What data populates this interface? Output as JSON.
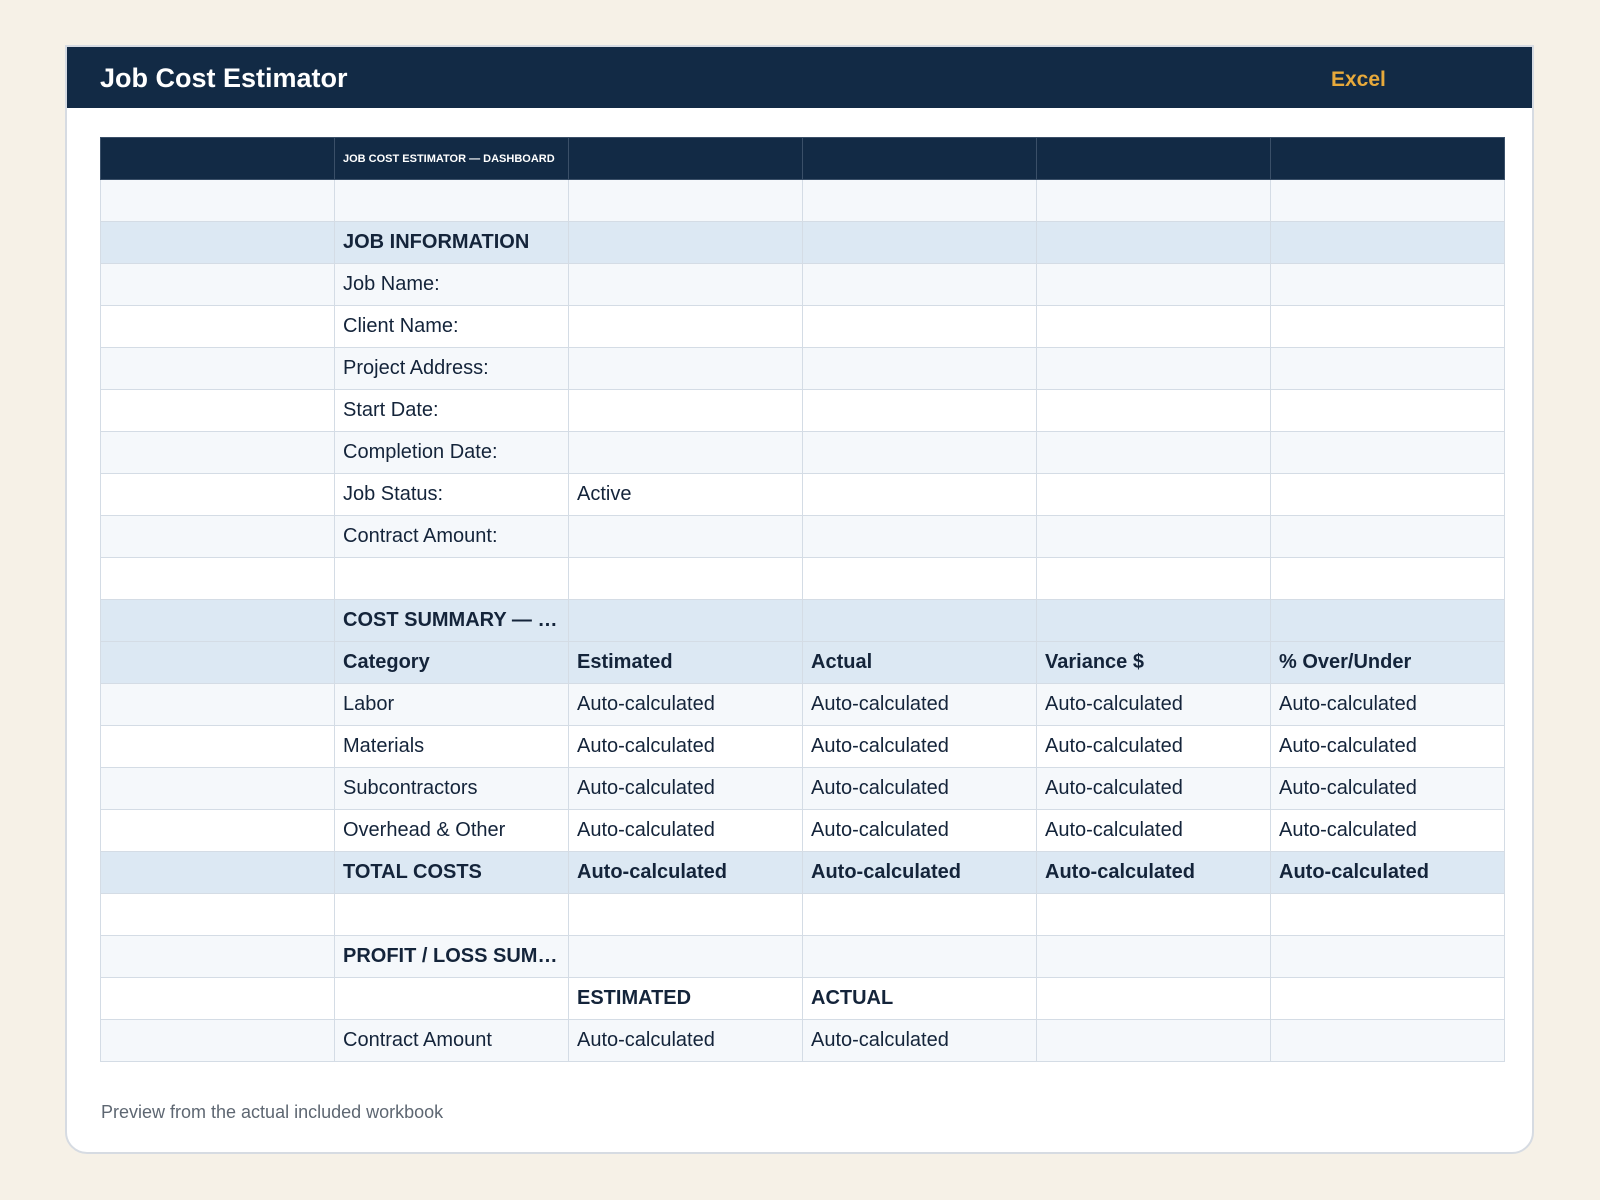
{
  "header": {
    "title": "Job Cost Estimator",
    "badge": "Excel"
  },
  "sheet": {
    "banner": "JOB COST ESTIMATOR — DASHBOARD",
    "job_info": {
      "heading": "JOB INFORMATION",
      "fields": [
        {
          "label": "Job Name:",
          "value": ""
        },
        {
          "label": "Client Name:",
          "value": ""
        },
        {
          "label": "Project Address:",
          "value": ""
        },
        {
          "label": "Start Date:",
          "value": ""
        },
        {
          "label": "Completion Date:",
          "value": ""
        },
        {
          "label": "Job Status:",
          "value": "Active"
        },
        {
          "label": "Contract Amount:",
          "value": ""
        }
      ]
    },
    "cost_summary": {
      "heading": "COST SUMMARY — ESTIMATED vs. ACTUAL",
      "columns": [
        "Category",
        "Estimated",
        "Actual",
        "Variance $",
        "% Over/Under"
      ],
      "rows": [
        [
          "Labor",
          "Auto-calculated",
          "Auto-calculated",
          "Auto-calculated",
          "Auto-calculated"
        ],
        [
          "Materials",
          "Auto-calculated",
          "Auto-calculated",
          "Auto-calculated",
          "Auto-calculated"
        ],
        [
          "Subcontractors",
          "Auto-calculated",
          "Auto-calculated",
          "Auto-calculated",
          "Auto-calculated"
        ],
        [
          "Overhead & Other",
          "Auto-calculated",
          "Auto-calculated",
          "Auto-calculated",
          "Auto-calculated"
        ]
      ],
      "total": [
        "TOTAL COSTS",
        "Auto-calculated",
        "Auto-calculated",
        "Auto-calculated",
        "Auto-calculated"
      ]
    },
    "profit_loss": {
      "heading": "PROFIT / LOSS SUMMARY",
      "columns": [
        "ESTIMATED",
        "ACTUAL"
      ],
      "rows": [
        [
          "Contract Amount",
          "Auto-calculated",
          "Auto-calculated"
        ]
      ]
    }
  },
  "footer": {
    "note": "Preview from the actual included workbook"
  },
  "colors": {
    "header_bg": "#122a45",
    "accent": "#e7a93b",
    "section_bg": "#dce8f3",
    "page_bg": "#f6f1e7"
  }
}
